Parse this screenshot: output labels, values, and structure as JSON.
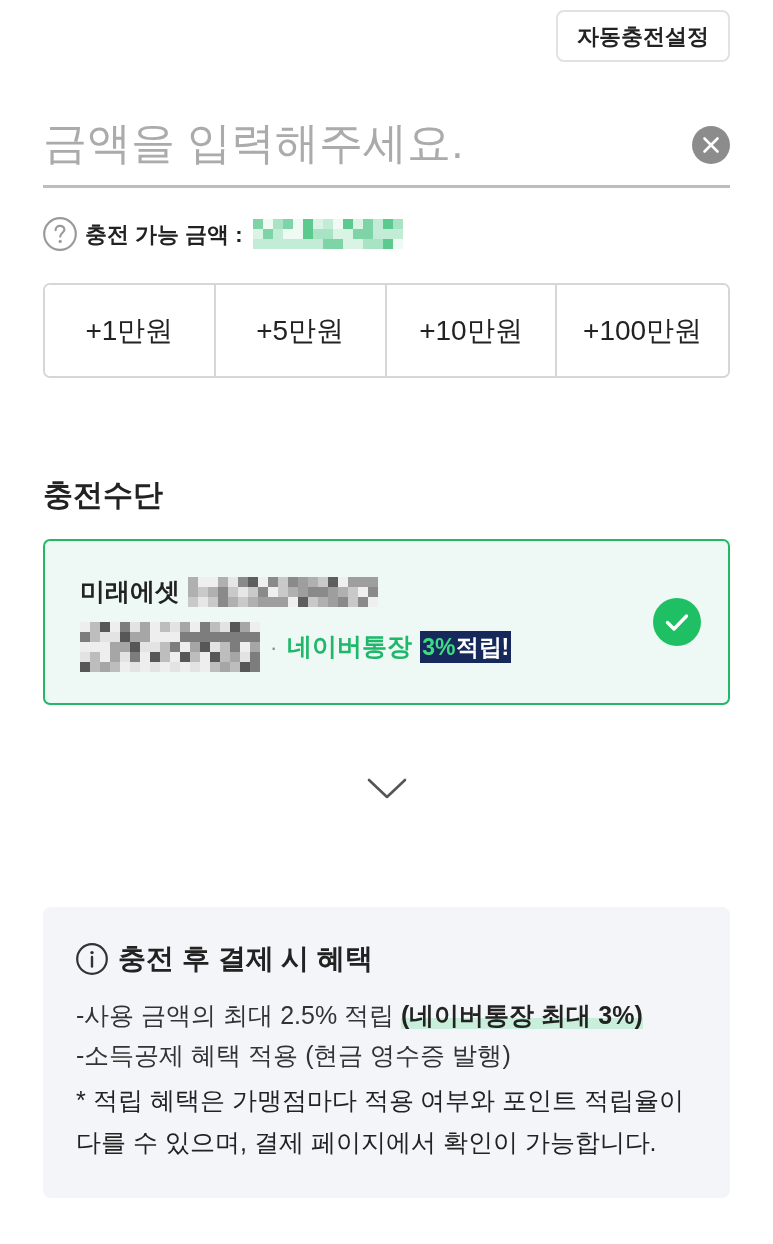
{
  "auto_charge_button": "자동충전설정",
  "amount_input": {
    "placeholder": "금액을 입력해주세요."
  },
  "available": {
    "label": "충전 가능 금액 :"
  },
  "quick_amounts": [
    "+1만원",
    "+5만원",
    "+10만원",
    "+100만원"
  ],
  "payment_section": {
    "title": "충전수단",
    "methods": [
      {
        "name": "미래에셋",
        "selected": true,
        "separator": "·",
        "benefit": "네이버통장",
        "badge_value": "3%",
        "badge_text": "적립!"
      }
    ],
    "expand_toggle": {
      "expanded": false
    }
  },
  "benefits": {
    "title": "충전 후 결제 시 혜택",
    "lines": [
      "-사용 금액의 최대 2.5% 적립 **(네이버통장 최대 3%)**",
      "-소득공제 혜택 적용 (현금 영수증 발행)"
    ],
    "note": "* 적립 혜택은 가맹점마다 적용 여부와 포인트 적립율이 다를 수 있으며, 결제 페이지에서 확인이 가능합니다."
  }
}
